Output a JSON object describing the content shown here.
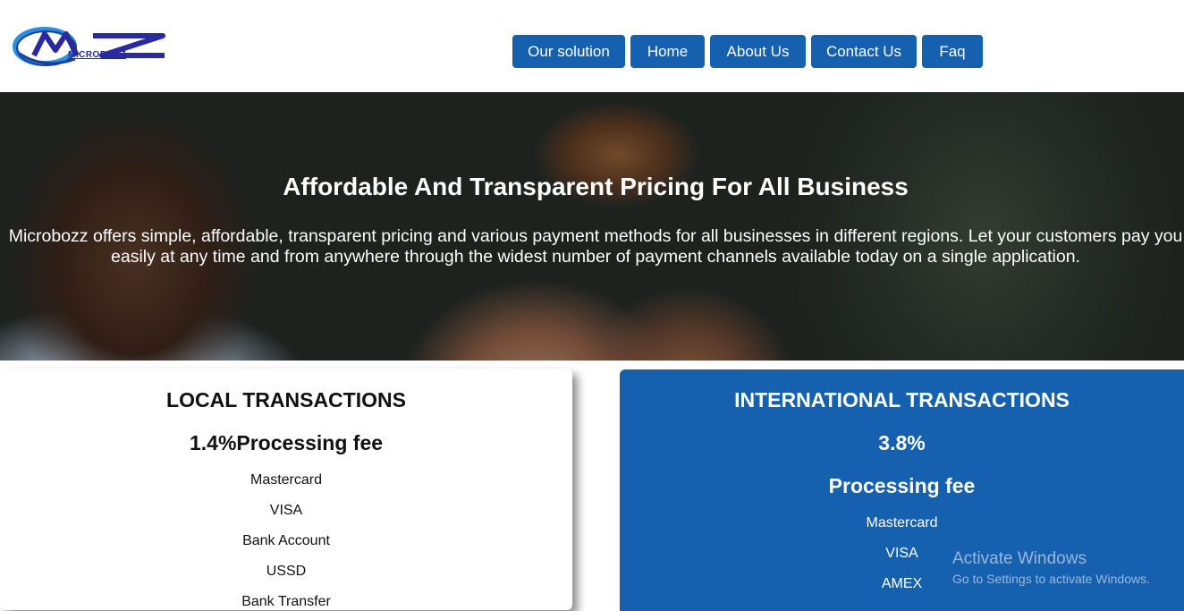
{
  "brand": {
    "logo_text": "MICROBOZZ",
    "logo_alt": "MZ Microbozz logo"
  },
  "nav": {
    "items": [
      {
        "label": "Our solution"
      },
      {
        "label": "Home"
      },
      {
        "label": "About Us"
      },
      {
        "label": "Contact Us"
      },
      {
        "label": "Faq"
      }
    ]
  },
  "hero": {
    "title": "Affordable And Transparent Pricing For All Business",
    "description": "Microbozz offers simple, affordable, transparent pricing and various payment methods for all businesses in different regions. Let your customers pay you easily at any time and from anywhere through the widest number of payment channels available today on a single application."
  },
  "local": {
    "title": "LOCAL TRANSACTIONS",
    "fee": "1.4%Processing fee",
    "methods": [
      "Mastercard",
      "VISA",
      "Bank Account",
      "USSD",
      "Bank Transfer"
    ]
  },
  "international": {
    "title": "INTERNATIONAL TRANSACTIONS",
    "rate": "3.8%",
    "fee_label": "Processing fee",
    "methods": [
      "Mastercard",
      "VISA",
      "AMEX"
    ]
  },
  "os_watermark": {
    "title": "Activate Windows",
    "subtitle": "Go to Settings to activate Windows."
  },
  "colors": {
    "primary": "#1660b0",
    "white": "#ffffff",
    "text_dark": "#111111"
  }
}
